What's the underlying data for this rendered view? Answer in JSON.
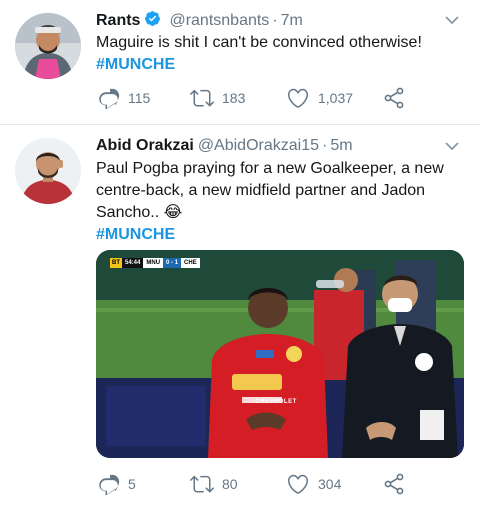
{
  "colors": {
    "link": "#1b95e0",
    "secondary": "#657786",
    "verified": "#1da1f2"
  },
  "tweets": [
    {
      "name": "Rants",
      "verified": true,
      "handle": "@rantsnbants",
      "separator": "·",
      "time": "7m",
      "text": "Maguire is shit I can't be convinced otherwise!",
      "hashtag": "#MUNCHE",
      "replies": "115",
      "retweets": "183",
      "likes": "1,037"
    },
    {
      "name": "Abid Orakzai",
      "verified": false,
      "handle": "@AbidOrakzai15",
      "separator": "·",
      "time": "5m",
      "text": "Paul Pogba praying for a new Goalkeeper, a new centre-back, a new midfield partner and Jadon Sancho.. 😂",
      "hashtag": "#MUNCHE",
      "media": {
        "scorebug": {
          "channel": "BT",
          "time": "54:44",
          "home": "MNU",
          "score": "0 - 1",
          "away": "CHE"
        },
        "shirt_sponsor": "CHEVROLET"
      },
      "replies": "5",
      "retweets": "80",
      "likes": "304"
    }
  ]
}
